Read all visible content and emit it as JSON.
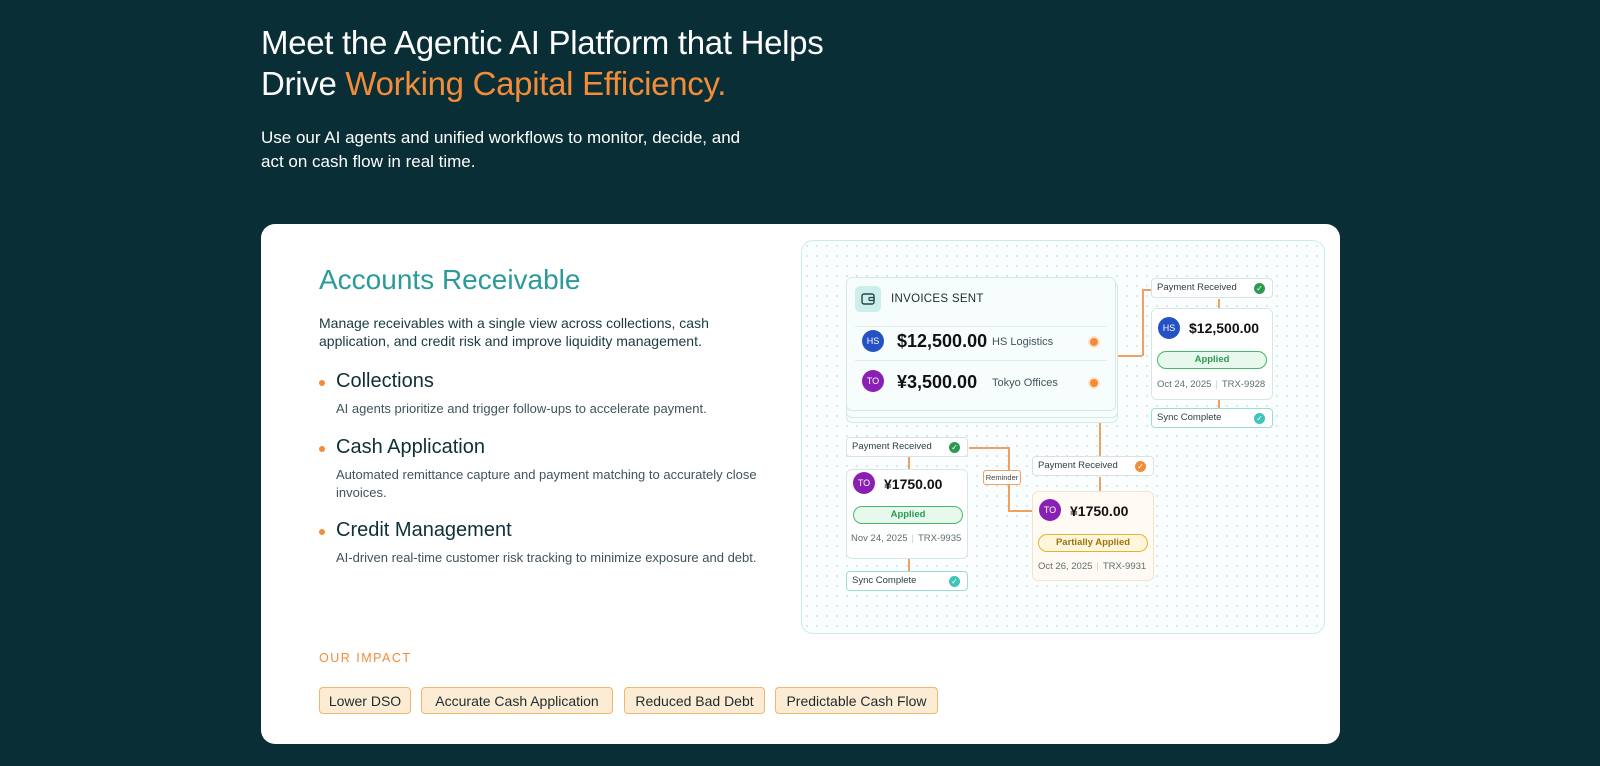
{
  "hero": {
    "title_line1": "Meet the Agentic AI Platform that Helps",
    "title_line2_prefix": "Drive ",
    "title_accent": "Working Capital Efficiency.",
    "subtitle": "Use our AI agents and unified workflows to monitor, decide, and act on cash flow in real time."
  },
  "section": {
    "title": "Accounts Receivable",
    "description": "Manage receivables with a single view across collections, cash application, and credit risk and improve liquidity management.",
    "features": [
      {
        "title": "Collections",
        "desc": "AI agents prioritize and trigger follow-ups to accelerate payment."
      },
      {
        "title": "Cash Application",
        "desc": "Automated remittance capture and payment matching to accurately close invoices."
      },
      {
        "title": "Credit Management",
        "desc": "AI-driven real-time customer risk tracking to minimize exposure and debt."
      }
    ],
    "impact_label": "OUR IMPACT",
    "impact_chips": [
      "Lower DSO",
      "Accurate Cash Application",
      "Reduced Bad Debt",
      "Predictable Cash Flow"
    ]
  },
  "diagram": {
    "invoices_header": "INVOICES SENT",
    "invoice_rows": [
      {
        "initials": "HS",
        "amount": "$12,500.00",
        "company": "HS Logistics"
      },
      {
        "initials": "TO",
        "amount": "¥3,500.00",
        "company": "Tokyo Offices"
      }
    ],
    "card_hs": {
      "tag_top": "Payment Received",
      "initials": "HS",
      "amount": "$12,500.00",
      "status": "Applied",
      "date": "Oct 24, 2025",
      "trx": "TRX-9928",
      "tag_bottom": "Sync Complete"
    },
    "card_to1": {
      "tag_top": "Payment Received",
      "initials": "TO",
      "amount": "¥1750.00",
      "status": "Applied",
      "date": "Nov 24, 2025",
      "trx": "TRX-9935",
      "tag_bottom": "Sync Complete"
    },
    "card_to2": {
      "tag_top": "Payment Received",
      "initials": "TO",
      "amount": "¥1750.00",
      "status": "Partially Applied",
      "date": "Oct 26, 2025",
      "trx": "TRX-9931"
    },
    "reminder_label": "Reminder",
    "colors": {
      "accent": "#f28c38",
      "teal": "#2a9a9a",
      "background": "#0a2e36"
    }
  }
}
